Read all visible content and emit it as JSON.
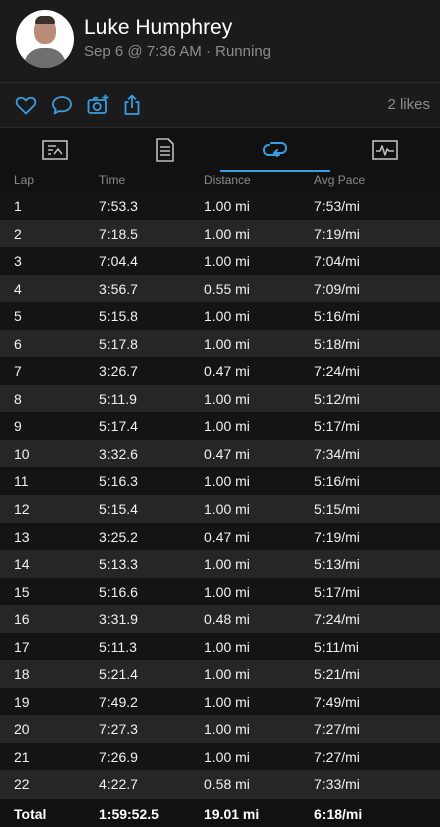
{
  "header": {
    "user_name": "Luke Humphrey",
    "activity_meta": "Sep 6 @ 7:36 AM · Running"
  },
  "actions": {
    "icons": [
      "heart-icon",
      "comment-icon",
      "camera-add-icon",
      "share-icon"
    ],
    "likes_text": "2 likes"
  },
  "tabs": [
    {
      "icon": "summary-icon",
      "active": false
    },
    {
      "icon": "details-icon",
      "active": false
    },
    {
      "icon": "laps-icon",
      "active": true
    },
    {
      "icon": "chart-icon",
      "active": false
    }
  ],
  "colors": {
    "accent": "#3a9de0",
    "background": "#111111",
    "row_alt": "#262626"
  },
  "table": {
    "headers": {
      "lap": "Lap",
      "time": "Time",
      "distance": "Distance",
      "pace": "Avg Pace"
    },
    "rows": [
      {
        "lap": "1",
        "time": "7:53.3",
        "distance": "1.00 mi",
        "pace": "7:53/mi"
      },
      {
        "lap": "2",
        "time": "7:18.5",
        "distance": "1.00 mi",
        "pace": "7:19/mi"
      },
      {
        "lap": "3",
        "time": "7:04.4",
        "distance": "1.00 mi",
        "pace": "7:04/mi"
      },
      {
        "lap": "4",
        "time": "3:56.7",
        "distance": "0.55 mi",
        "pace": "7:09/mi"
      },
      {
        "lap": "5",
        "time": "5:15.8",
        "distance": "1.00 mi",
        "pace": "5:16/mi"
      },
      {
        "lap": "6",
        "time": "5:17.8",
        "distance": "1.00 mi",
        "pace": "5:18/mi"
      },
      {
        "lap": "7",
        "time": "3:26.7",
        "distance": "0.47 mi",
        "pace": "7:24/mi"
      },
      {
        "lap": "8",
        "time": "5:11.9",
        "distance": "1.00 mi",
        "pace": "5:12/mi"
      },
      {
        "lap": "9",
        "time": "5:17.4",
        "distance": "1.00 mi",
        "pace": "5:17/mi"
      },
      {
        "lap": "10",
        "time": "3:32.6",
        "distance": "0.47 mi",
        "pace": "7:34/mi"
      },
      {
        "lap": "11",
        "time": "5:16.3",
        "distance": "1.00 mi",
        "pace": "5:16/mi"
      },
      {
        "lap": "12",
        "time": "5:15.4",
        "distance": "1.00 mi",
        "pace": "5:15/mi"
      },
      {
        "lap": "13",
        "time": "3:25.2",
        "distance": "0.47 mi",
        "pace": "7:19/mi"
      },
      {
        "lap": "14",
        "time": "5:13.3",
        "distance": "1.00 mi",
        "pace": "5:13/mi"
      },
      {
        "lap": "15",
        "time": "5:16.6",
        "distance": "1.00 mi",
        "pace": "5:17/mi"
      },
      {
        "lap": "16",
        "time": "3:31.9",
        "distance": "0.48 mi",
        "pace": "7:24/mi"
      },
      {
        "lap": "17",
        "time": "5:11.3",
        "distance": "1.00 mi",
        "pace": "5:11/mi"
      },
      {
        "lap": "18",
        "time": "5:21.4",
        "distance": "1.00 mi",
        "pace": "5:21/mi"
      },
      {
        "lap": "19",
        "time": "7:49.2",
        "distance": "1.00 mi",
        "pace": "7:49/mi"
      },
      {
        "lap": "20",
        "time": "7:27.3",
        "distance": "1.00 mi",
        "pace": "7:27/mi"
      },
      {
        "lap": "21",
        "time": "7:26.9",
        "distance": "1.00 mi",
        "pace": "7:27/mi"
      },
      {
        "lap": "22",
        "time": "4:22.7",
        "distance": "0.58 mi",
        "pace": "7:33/mi"
      }
    ],
    "total": {
      "label": "Total",
      "time": "1:59:52.5",
      "distance": "19.01 mi",
      "pace": "6:18/mi"
    }
  }
}
